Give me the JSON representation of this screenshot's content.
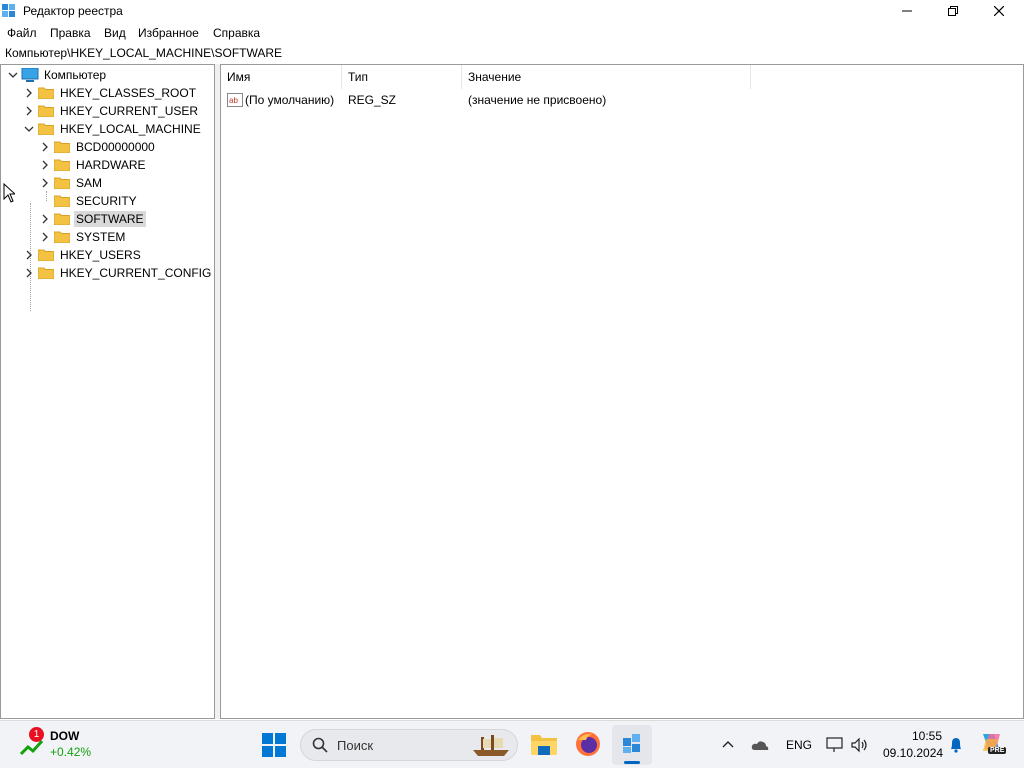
{
  "window": {
    "title": "Редактор реестра"
  },
  "menu": [
    "Файл",
    "Правка",
    "Вид",
    "Избранное",
    "Справка"
  ],
  "address": "Компьютер\\HKEY_LOCAL_MACHINE\\SOFTWARE",
  "tree": {
    "root": "Компьютер",
    "hives": [
      "HKEY_CLASSES_ROOT",
      "HKEY_CURRENT_USER",
      "HKEY_LOCAL_MACHINE",
      "HKEY_USERS",
      "HKEY_CURRENT_CONFIG"
    ],
    "hklm_children": [
      "BCD00000000",
      "HARDWARE",
      "SAM",
      "SECURITY",
      "SOFTWARE",
      "SYSTEM"
    ],
    "selected": "SOFTWARE"
  },
  "list": {
    "columns": [
      "Имя",
      "Тип",
      "Значение"
    ],
    "rows": [
      {
        "name": "(По умолчанию)",
        "type": "REG_SZ",
        "value": "(значение не присвоено)"
      }
    ]
  },
  "taskbar": {
    "widget": {
      "badge": "1",
      "ticker": "DOW",
      "change": "+0.42%"
    },
    "search_placeholder": "Поиск",
    "language": "ENG",
    "time": "10:55",
    "date": "09.10.2024",
    "copilot_badge": "PRE"
  },
  "colors": {
    "folder": "#f4c242",
    "accent": "#0067c0",
    "positive": "#13a10e",
    "badge": "#e81123"
  }
}
